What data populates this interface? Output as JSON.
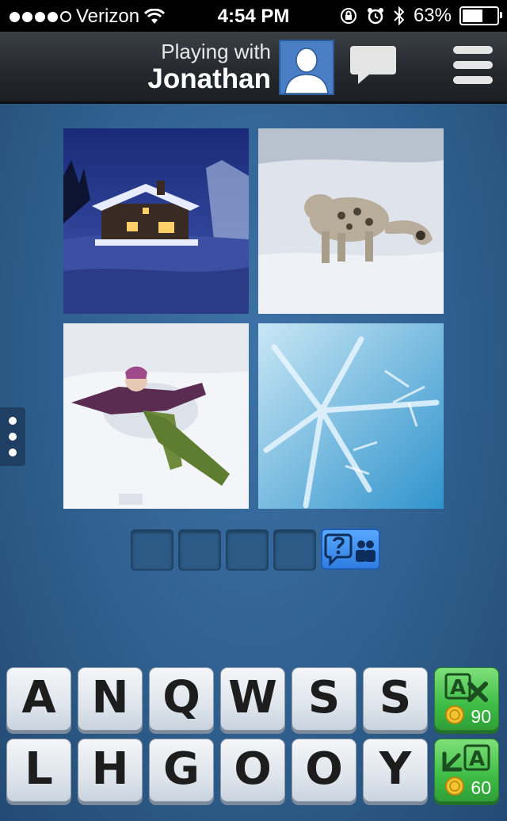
{
  "status_bar": {
    "carrier": "Verizon",
    "time": "4:54 PM",
    "battery": "63%",
    "battery_level": 0.63,
    "signal_bars": 4
  },
  "header": {
    "playing_label": "Playing with",
    "player_name": "Jonathan"
  },
  "photos": [
    {
      "name": "snowy-cabin-night-photo"
    },
    {
      "name": "snow-leopard-photo"
    },
    {
      "name": "snow-angel-photo"
    },
    {
      "name": "snowflake-photo"
    }
  ],
  "answer": {
    "slots": [
      "",
      "",
      "",
      ""
    ]
  },
  "keyboard": {
    "row1": [
      "A",
      "N",
      "Q",
      "W",
      "S",
      "S"
    ],
    "row2": [
      "L",
      "H",
      "G",
      "O",
      "O",
      "Y"
    ],
    "remove_letters_cost": "90",
    "reveal_letter_cost": "60"
  },
  "colors": {
    "background": "#2f5f8e",
    "header": "#262a2f",
    "powerup_green": "#3ebc45",
    "hint_blue": "#2f7de0"
  },
  "icons": [
    "wifi-icon",
    "lock-rotation-icon",
    "alarm-icon",
    "bluetooth-icon",
    "battery-icon",
    "chat-icon",
    "menu-icon",
    "more-dots-icon",
    "hint-question-icon",
    "friends-icon",
    "coin-icon"
  ]
}
